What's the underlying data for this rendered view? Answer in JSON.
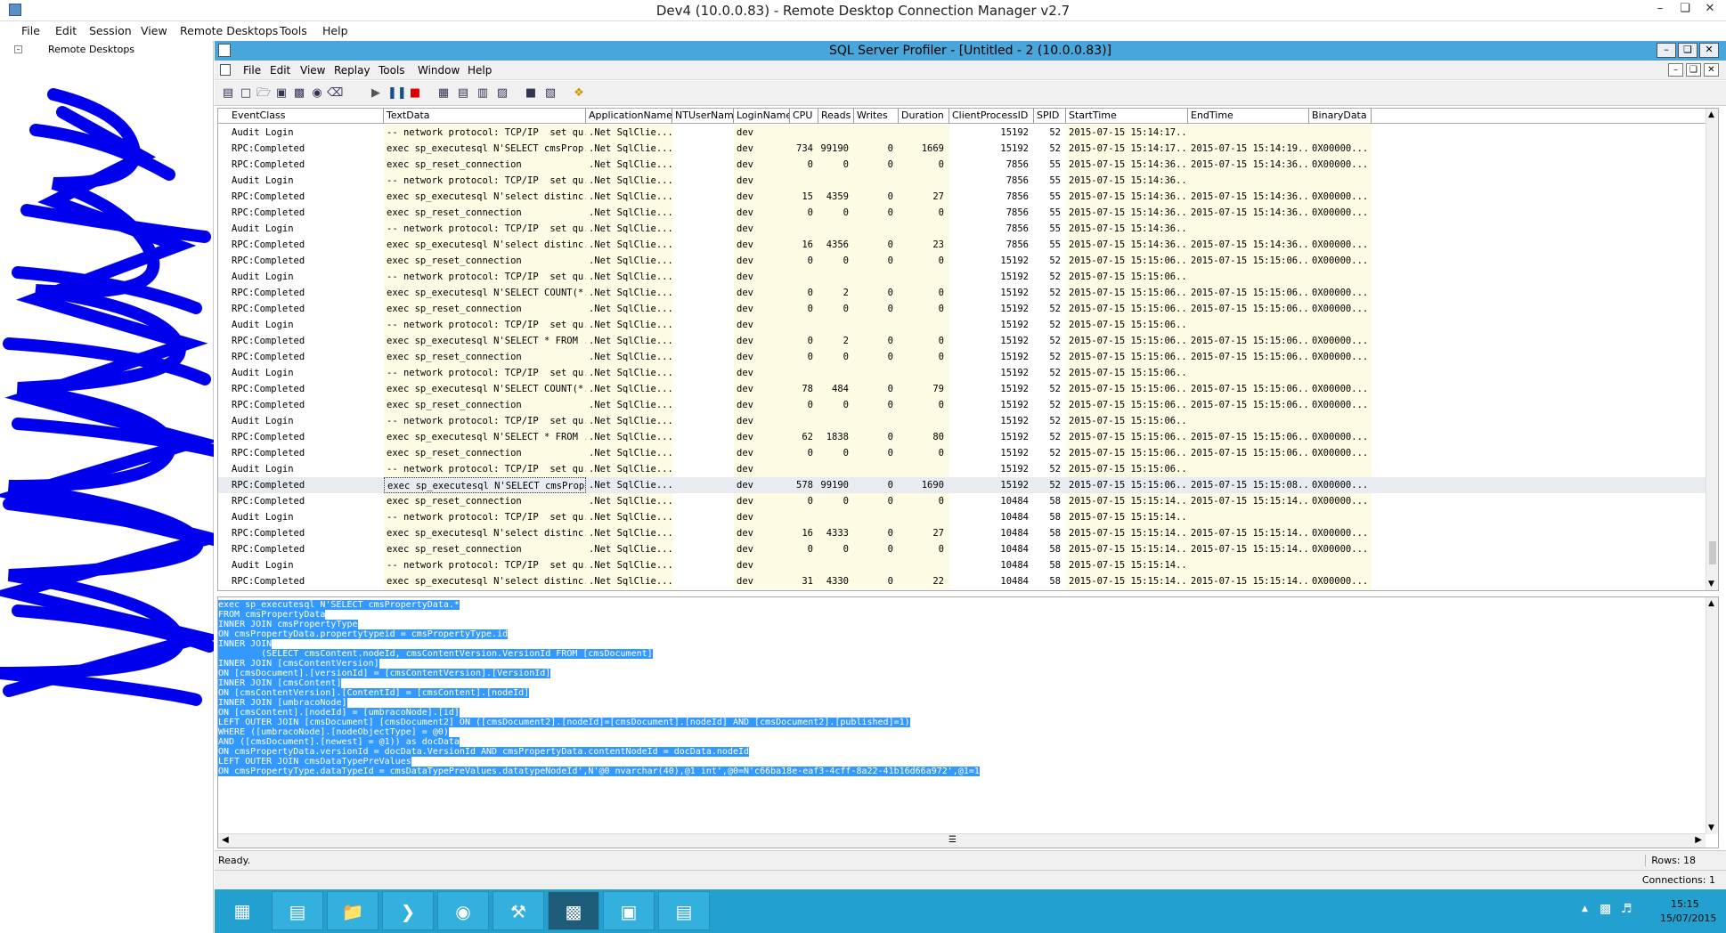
{
  "outer_window": {
    "title": "Dev4 (10.0.0.83) - Remote Desktop Connection Manager v2.7"
  },
  "outer_menu": [
    "File",
    "Edit",
    "Session",
    "View",
    "Remote Desktops",
    "Tools",
    "Help"
  ],
  "tree": {
    "root": "Remote Desktops"
  },
  "profiler": {
    "title": "SQL Server Profiler - [Untitled - 2 (10.0.0.83)]",
    "menu": [
      "File",
      "Edit",
      "View",
      "Replay",
      "Tools",
      "Window",
      "Help"
    ]
  },
  "grid": {
    "columns": [
      "EventClass",
      "TextData",
      "ApplicationName",
      "NTUserName",
      "LoginName",
      "CPU",
      "Reads",
      "Writes",
      "Duration",
      "ClientProcessID",
      "SPID",
      "StartTime",
      "EndTime",
      "BinaryData"
    ],
    "selected_row": 22,
    "rows": [
      [
        "Audit Login",
        "-- network protocol: TCP/IP  set qu...",
        ".Net SqlClie...",
        "",
        "dev",
        "",
        "",
        "",
        "",
        "15192",
        "52",
        "2015-07-15 15:14:17...",
        "",
        ""
      ],
      [
        "RPC:Completed",
        "exec sp_executesql N'SELECT cmsProp...",
        ".Net SqlClie...",
        "",
        "dev",
        "734",
        "99190",
        "0",
        "1669",
        "15192",
        "52",
        "2015-07-15 15:14:17...",
        "2015-07-15 15:14:19...",
        "0X00000..."
      ],
      [
        "RPC:Completed",
        "exec sp_reset_connection",
        ".Net SqlClie...",
        "",
        "dev",
        "0",
        "0",
        "0",
        "0",
        "7856",
        "55",
        "2015-07-15 15:14:36...",
        "2015-07-15 15:14:36...",
        "0X00000..."
      ],
      [
        "Audit Login",
        "-- network protocol: TCP/IP  set qu...",
        ".Net SqlClie...",
        "",
        "dev",
        "",
        "",
        "",
        "",
        "7856",
        "55",
        "2015-07-15 15:14:36...",
        "",
        ""
      ],
      [
        "RPC:Completed",
        "exec sp_executesql N'select distinc...",
        ".Net SqlClie...",
        "",
        "dev",
        "15",
        "4359",
        "0",
        "27",
        "7856",
        "55",
        "2015-07-15 15:14:36...",
        "2015-07-15 15:14:36...",
        "0X00000..."
      ],
      [
        "RPC:Completed",
        "exec sp_reset_connection",
        ".Net SqlClie...",
        "",
        "dev",
        "0",
        "0",
        "0",
        "0",
        "7856",
        "55",
        "2015-07-15 15:14:36...",
        "2015-07-15 15:14:36...",
        "0X00000..."
      ],
      [
        "Audit Login",
        "-- network protocol: TCP/IP  set qu...",
        ".Net SqlClie...",
        "",
        "dev",
        "",
        "",
        "",
        "",
        "7856",
        "55",
        "2015-07-15 15:14:36...",
        "",
        ""
      ],
      [
        "RPC:Completed",
        "exec sp_executesql N'select distinc...",
        ".Net SqlClie...",
        "",
        "dev",
        "16",
        "4356",
        "0",
        "23",
        "7856",
        "55",
        "2015-07-15 15:14:36...",
        "2015-07-15 15:14:36...",
        "0X00000..."
      ],
      [
        "RPC:Completed",
        "exec sp_reset_connection",
        ".Net SqlClie...",
        "",
        "dev",
        "0",
        "0",
        "0",
        "0",
        "15192",
        "52",
        "2015-07-15 15:15:06...",
        "2015-07-15 15:15:06...",
        "0X00000..."
      ],
      [
        "Audit Login",
        "-- network protocol: TCP/IP  set qu...",
        ".Net SqlClie...",
        "",
        "dev",
        "",
        "",
        "",
        "",
        "15192",
        "52",
        "2015-07-15 15:15:06...",
        "",
        ""
      ],
      [
        "RPC:Completed",
        "exec sp_executesql N'SELECT COUNT(*...",
        ".Net SqlClie...",
        "",
        "dev",
        "0",
        "2",
        "0",
        "0",
        "15192",
        "52",
        "2015-07-15 15:15:06...",
        "2015-07-15 15:15:06...",
        "0X00000..."
      ],
      [
        "RPC:Completed",
        "exec sp_reset_connection",
        ".Net SqlClie...",
        "",
        "dev",
        "0",
        "0",
        "0",
        "0",
        "15192",
        "52",
        "2015-07-15 15:15:06...",
        "2015-07-15 15:15:06...",
        "0X00000..."
      ],
      [
        "Audit Login",
        "-- network protocol: TCP/IP  set qu...",
        ".Net SqlClie...",
        "",
        "dev",
        "",
        "",
        "",
        "",
        "15192",
        "52",
        "2015-07-15 15:15:06...",
        "",
        ""
      ],
      [
        "RPC:Completed",
        "exec sp_executesql N'SELECT * FROM ...",
        ".Net SqlClie...",
        "",
        "dev",
        "0",
        "2",
        "0",
        "0",
        "15192",
        "52",
        "2015-07-15 15:15:06...",
        "2015-07-15 15:15:06...",
        "0X00000..."
      ],
      [
        "RPC:Completed",
        "exec sp_reset_connection",
        ".Net SqlClie...",
        "",
        "dev",
        "0",
        "0",
        "0",
        "0",
        "15192",
        "52",
        "2015-07-15 15:15:06...",
        "2015-07-15 15:15:06...",
        "0X00000..."
      ],
      [
        "Audit Login",
        "-- network protocol: TCP/IP  set qu...",
        ".Net SqlClie...",
        "",
        "dev",
        "",
        "",
        "",
        "",
        "15192",
        "52",
        "2015-07-15 15:15:06...",
        "",
        ""
      ],
      [
        "RPC:Completed",
        "exec sp_executesql N'SELECT COUNT(*...",
        ".Net SqlClie...",
        "",
        "dev",
        "78",
        "484",
        "0",
        "79",
        "15192",
        "52",
        "2015-07-15 15:15:06...",
        "2015-07-15 15:15:06...",
        "0X00000..."
      ],
      [
        "RPC:Completed",
        "exec sp_reset_connection",
        ".Net SqlClie...",
        "",
        "dev",
        "0",
        "0",
        "0",
        "0",
        "15192",
        "52",
        "2015-07-15 15:15:06...",
        "2015-07-15 15:15:06...",
        "0X00000..."
      ],
      [
        "Audit Login",
        "-- network protocol: TCP/IP  set qu...",
        ".Net SqlClie...",
        "",
        "dev",
        "",
        "",
        "",
        "",
        "15192",
        "52",
        "2015-07-15 15:15:06...",
        "",
        ""
      ],
      [
        "RPC:Completed",
        "exec sp_executesql N'SELECT * FROM ...",
        ".Net SqlClie...",
        "",
        "dev",
        "62",
        "1838",
        "0",
        "80",
        "15192",
        "52",
        "2015-07-15 15:15:06...",
        "2015-07-15 15:15:06...",
        "0X00000..."
      ],
      [
        "RPC:Completed",
        "exec sp_reset_connection",
        ".Net SqlClie...",
        "",
        "dev",
        "0",
        "0",
        "0",
        "0",
        "15192",
        "52",
        "2015-07-15 15:15:06...",
        "2015-07-15 15:15:06...",
        "0X00000..."
      ],
      [
        "Audit Login",
        "-- network protocol: TCP/IP  set qu...",
        ".Net SqlClie...",
        "",
        "dev",
        "",
        "",
        "",
        "",
        "15192",
        "52",
        "2015-07-15 15:15:06...",
        "",
        ""
      ],
      [
        "RPC:Completed",
        "exec sp_executesql N'SELECT cmsProp...",
        ".Net SqlClie...",
        "",
        "dev",
        "578",
        "99190",
        "0",
        "1690",
        "15192",
        "52",
        "2015-07-15 15:15:06...",
        "2015-07-15 15:15:08...",
        "0X00000..."
      ],
      [
        "RPC:Completed",
        "exec sp_reset_connection",
        ".Net SqlClie...",
        "",
        "dev",
        "0",
        "0",
        "0",
        "0",
        "10484",
        "58",
        "2015-07-15 15:15:14...",
        "2015-07-15 15:15:14...",
        "0X00000..."
      ],
      [
        "Audit Login",
        "-- network protocol: TCP/IP  set qu...",
        ".Net SqlClie...",
        "",
        "dev",
        "",
        "",
        "",
        "",
        "10484",
        "58",
        "2015-07-15 15:15:14...",
        "",
        ""
      ],
      [
        "RPC:Completed",
        "exec sp_executesql N'select distinc...",
        ".Net SqlClie...",
        "",
        "dev",
        "16",
        "4333",
        "0",
        "27",
        "10484",
        "58",
        "2015-07-15 15:15:14...",
        "2015-07-15 15:15:14...",
        "0X00000..."
      ],
      [
        "RPC:Completed",
        "exec sp_reset_connection",
        ".Net SqlClie...",
        "",
        "dev",
        "0",
        "0",
        "0",
        "0",
        "10484",
        "58",
        "2015-07-15 15:15:14...",
        "2015-07-15 15:15:14...",
        "0X00000..."
      ],
      [
        "Audit Login",
        "-- network protocol: TCP/IP  set qu...",
        ".Net SqlClie...",
        "",
        "dev",
        "",
        "",
        "",
        "",
        "10484",
        "58",
        "2015-07-15 15:15:14...",
        "",
        ""
      ],
      [
        "RPC:Completed",
        "exec sp_executesql N'select distinc...",
        ".Net SqlClie...",
        "",
        "dev",
        "31",
        "4330",
        "0",
        "22",
        "10484",
        "58",
        "2015-07-15 15:15:14...",
        "2015-07-15 15:15:14...",
        "0X00000..."
      ]
    ]
  },
  "detail": {
    "lines": [
      "exec sp_executesql N'SELECT cmsPropertyData.*",
      "FROM cmsPropertyData",
      "INNER JOIN cmsPropertyType",
      "ON cmsPropertyData.propertytypeid = cmsPropertyType.id",
      "INNER JOIN",
      "        (SELECT cmsContent.nodeId, cmsContentVersion.VersionId FROM [cmsDocument]",
      "INNER JOIN [cmsContentVersion]",
      "ON [cmsDocument].[versionId] = [cmsContentVersion].[VersionId]",
      "INNER JOIN [cmsContent]",
      "ON [cmsContentVersion].[ContentId] = [cmsContent].[nodeId]",
      "INNER JOIN [umbracoNode]",
      "ON [cmsContent].[nodeId] = [umbracoNode].[id]",
      "LEFT OUTER JOIN [cmsDocument] [cmsDocument2] ON ([cmsDocument2].[nodeId]=[cmsDocument].[nodeId] AND [cmsDocument2].[published]=1)",
      "WHERE ([umbracoNode].[nodeObjectType] = @0)",
      "AND ([cmsDocument].[newest] = @1)) as docData",
      "ON cmsPropertyData.versionId = docData.VersionId AND cmsPropertyData.contentNodeId = docData.nodeId",
      "LEFT OUTER JOIN cmsDataTypePreValues",
      "ON cmsPropertyType.dataTypeId = cmsDataTypePreValues.datatypeNodeId',N'@0 nvarchar(40),@1 int',@0=N'c66ba18e-eaf3-4cff-8a22-41b16d66a972',@1=1"
    ]
  },
  "status": {
    "ready": "Ready.",
    "rows": "Rows: 18",
    "connections": "Connections: 1"
  },
  "tray": {
    "time": "15:15",
    "date": "15/07/2015"
  },
  "taskbar_icons": [
    "windows-start-icon",
    "server-manager-icon",
    "file-explorer-icon",
    "powershell-icon",
    "chrome-icon",
    "tools-icon",
    "cmd-icon",
    "rdcman-icon",
    "profiler-icon"
  ],
  "colors": {
    "profiler_titlebar": "#49a6db",
    "taskbar": "#22a1d0",
    "selection": "#3399ff",
    "cell_highlight": "#fdfbe3"
  }
}
